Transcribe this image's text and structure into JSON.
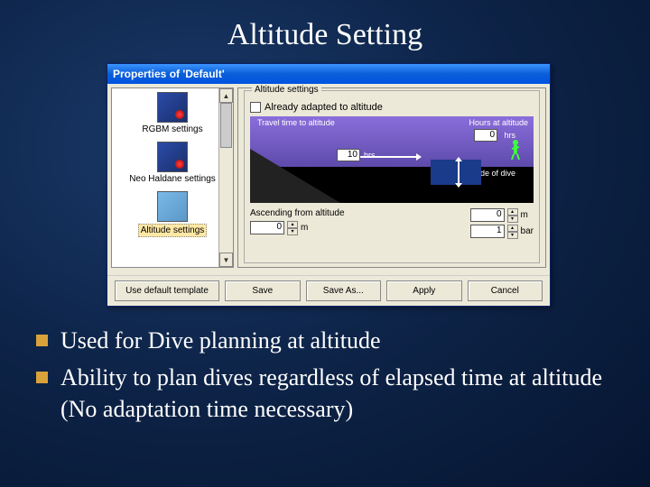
{
  "slide": {
    "title": "Altitude Setting"
  },
  "window": {
    "title": "Properties of 'Default'",
    "sidebar": {
      "items": [
        {
          "label": "RGBM settings"
        },
        {
          "label": "Neo Haldane settings"
        },
        {
          "label": "Altitude settings",
          "selected": true
        }
      ]
    },
    "panel": {
      "group_label": "Altitude settings",
      "checkbox_label": "Already adapted to altitude",
      "diagram": {
        "hours_label": "Hours at altitude",
        "hours_value": "0",
        "hours_unit": "hrs",
        "travel_label": "Travel time to altitude",
        "travel_value": "10",
        "travel_unit": "hrs",
        "altdive_label": "Altitude of dive"
      },
      "fields": {
        "ascend_label": "Ascending from altitude",
        "ascend_value": "0",
        "ascend_unit": "m",
        "altdive_value": "0",
        "altdive_unit": "m",
        "bar_value": "1",
        "bar_unit": "bar"
      }
    },
    "buttons": {
      "template": "Use default template",
      "save": "Save",
      "saveas": "Save As...",
      "apply": "Apply",
      "cancel": "Cancel"
    }
  },
  "bullets": [
    "Used for Dive planning at altitude",
    "Ability to plan dives regardless of elapsed time at altitude (No adaptation time necessary)"
  ]
}
